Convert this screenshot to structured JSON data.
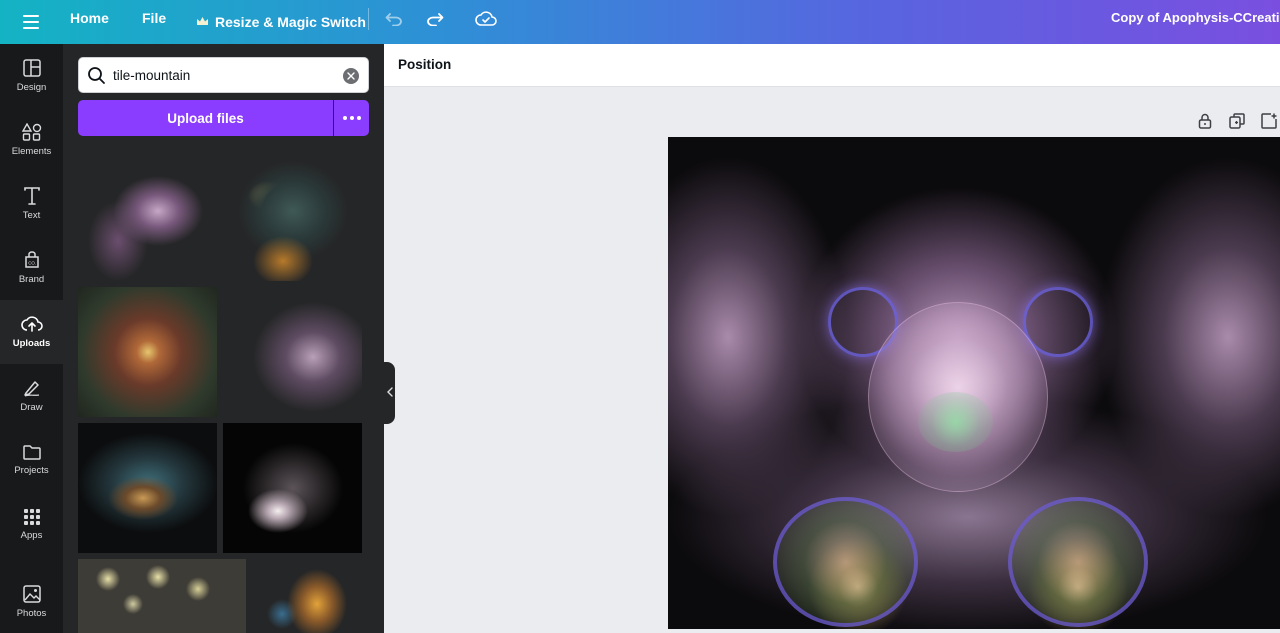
{
  "topbar": {
    "home_label": "Home",
    "file_label": "File",
    "resize_label": "Resize & Magic Switch",
    "document_title": "Copy of Apophysis-CCreatic"
  },
  "rail": {
    "items": [
      {
        "label": "Design",
        "icon": "layout-icon"
      },
      {
        "label": "Elements",
        "icon": "shapes-icon"
      },
      {
        "label": "Text",
        "icon": "text-icon"
      },
      {
        "label": "Brand",
        "icon": "brand-icon"
      },
      {
        "label": "Uploads",
        "icon": "cloud-upload-icon",
        "active": true
      },
      {
        "label": "Draw",
        "icon": "pen-icon"
      },
      {
        "label": "Projects",
        "icon": "folder-icon"
      },
      {
        "label": "Apps",
        "icon": "apps-grid-icon"
      },
      {
        "label": "Photos",
        "icon": "image-icon"
      }
    ]
  },
  "panel": {
    "search_value": "tile-mountain",
    "upload_label": "Upload files"
  },
  "canvas": {
    "context_label": "Position"
  },
  "colors": {
    "accent": "#8b3dff",
    "rail_bg": "#18191b",
    "panel_bg": "#252627",
    "canvas_bg": "#ebecf0"
  }
}
